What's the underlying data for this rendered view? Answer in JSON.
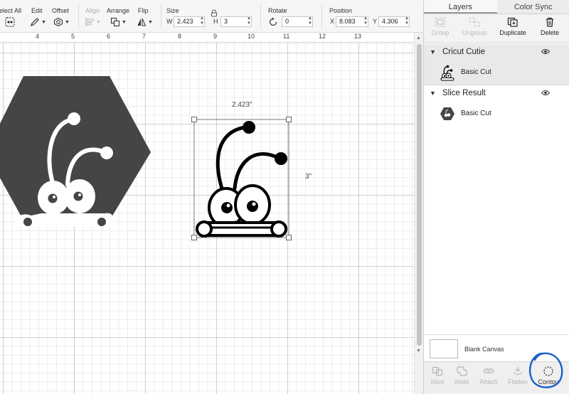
{
  "toolbar": {
    "select_all": "elect All",
    "edit": "Edit",
    "offset": "Offset",
    "align": "Align",
    "arrange": "Arrange",
    "flip": "Flip",
    "size": "Size",
    "w_label": "W",
    "w_value": "2.423",
    "h_label": "H",
    "h_value": "3",
    "rotate": "Rotate",
    "rotate_value": "0",
    "position": "Position",
    "x_label": "X",
    "x_value": "8.083",
    "y_label": "Y",
    "y_value": "4.306"
  },
  "ruler": {
    "ticks": [
      "4",
      "5",
      "6",
      "7",
      "8",
      "9",
      "10",
      "11",
      "12",
      "13"
    ]
  },
  "canvas": {
    "width_label": "2.423\"",
    "height_label": "3\""
  },
  "panel": {
    "tabs": [
      {
        "label": "Layers",
        "active": true
      },
      {
        "label": "Color Sync",
        "active": false
      }
    ],
    "actions": {
      "group": "Group",
      "ungroup": "Ungroup",
      "duplicate": "Duplicate",
      "delete": "Delete"
    },
    "layer_groups": [
      {
        "name": "Cricut Cutie",
        "operation": "Basic Cut"
      },
      {
        "name": "Slice Result",
        "operation": "Basic Cut"
      }
    ],
    "blank_canvas": "Blank Canvas",
    "bottom": {
      "slice": "Slice",
      "weld": "Weld",
      "attach": "Attach",
      "flatten": "Flatten",
      "contour": "Contou"
    }
  },
  "colors": {
    "hexagon_fill": "#454545",
    "selected_row_bg": "#e9e9e9",
    "annotation_circle": "#1a5fc8"
  }
}
